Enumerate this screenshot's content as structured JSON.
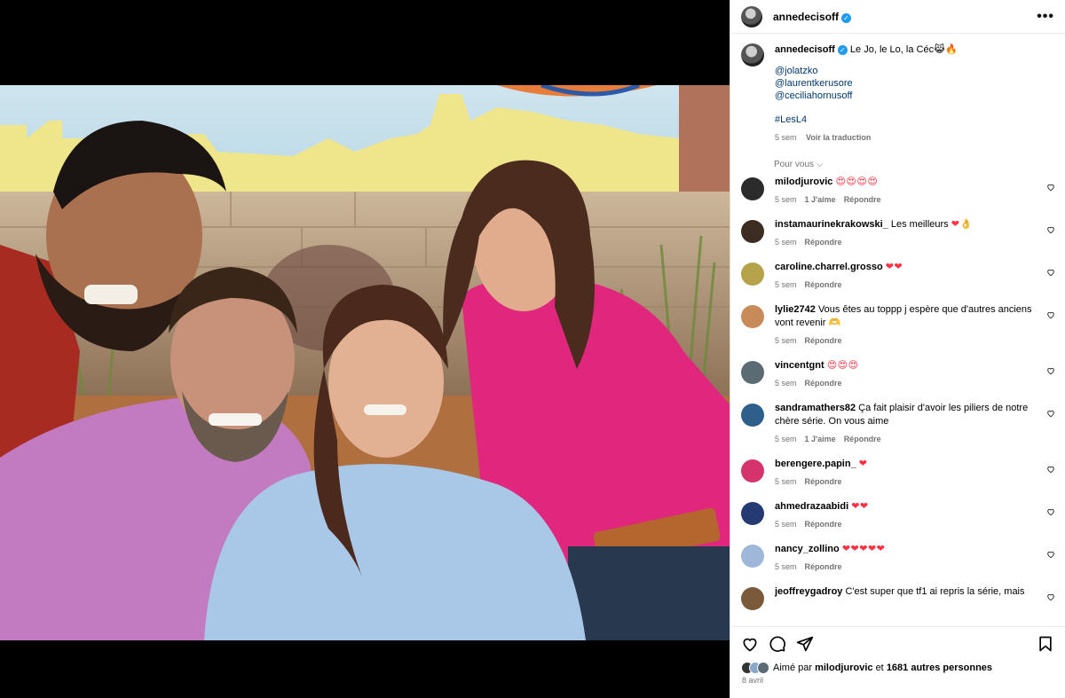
{
  "post": {
    "author": "annedecisoff",
    "caption": "Le Jo, le Lo, la Céc",
    "caption_emoji": "😹🔥",
    "mentions": [
      "@jolatzko",
      "@laurentkerusore",
      "@ceciliahornusoff"
    ],
    "hashtag": "#LesL4",
    "age": "5 sem",
    "translate": "Voir la traduction",
    "likes_prefix": "Aimé par",
    "likes_user": "milodjurovic",
    "likes_and": "et",
    "likes_count": "1681 autres personnes",
    "date": "8 avril"
  },
  "ui": {
    "more_icon": "more-dots-icon",
    "for_you": "Pour vous",
    "reply": "Répondre",
    "colors": {
      "link": "#00376b",
      "muted": "#737373",
      "verified": "#1d9bf0",
      "heart": "#ff3040"
    }
  },
  "comments": [
    {
      "user": "milodjurovic",
      "text": "",
      "emoji": "😍😍😍😍",
      "age": "5 sem",
      "likes": "1 J'aime",
      "avatar": "#2b2b2b"
    },
    {
      "user": "instamaurinekrakowski_",
      "text": "Les meilleurs",
      "emoji": "❤👌",
      "age": "5 sem",
      "likes": "",
      "avatar": "#3d2c22"
    },
    {
      "user": "caroline.charrel.grosso",
      "text": "",
      "emoji": "❤❤",
      "age": "5 sem",
      "likes": "",
      "avatar": "#b5a24a"
    },
    {
      "user": "lylie2742",
      "text": "Vous êtes au toppp j espère que d'autres anciens vont revenir",
      "emoji": "🫶",
      "age": "5 sem",
      "likes": "",
      "avatar": "#c98a5a"
    },
    {
      "user": "vincentgnt",
      "text": "",
      "emoji": "😍😍😍",
      "age": "5 sem",
      "likes": "",
      "avatar": "#5a6b74"
    },
    {
      "user": "sandramathers82",
      "text": "Ça fait plaisir d'avoir les piliers de notre chère série. On vous aime",
      "emoji": "",
      "age": "5 sem",
      "likes": "1 J'aime",
      "avatar": "#2e5f8a"
    },
    {
      "user": "berengere.papin_",
      "text": "",
      "emoji": "❤",
      "age": "5 sem",
      "likes": "",
      "avatar": "#d6336c"
    },
    {
      "user": "ahmedrazaabidi",
      "text": "",
      "emoji": "❤❤",
      "age": "5 sem",
      "likes": "",
      "avatar": "#233a73"
    },
    {
      "user": "nancy_zollino",
      "text": "",
      "emoji": "❤❤❤❤❤",
      "age": "5 sem",
      "likes": "",
      "avatar": "#9fb7d9"
    },
    {
      "user": "jeoffreygadroy",
      "text": "C'est super que tf1 ai repris la série, mais",
      "emoji": "",
      "age": "",
      "likes": "",
      "avatar": "#7a5a3a"
    }
  ]
}
